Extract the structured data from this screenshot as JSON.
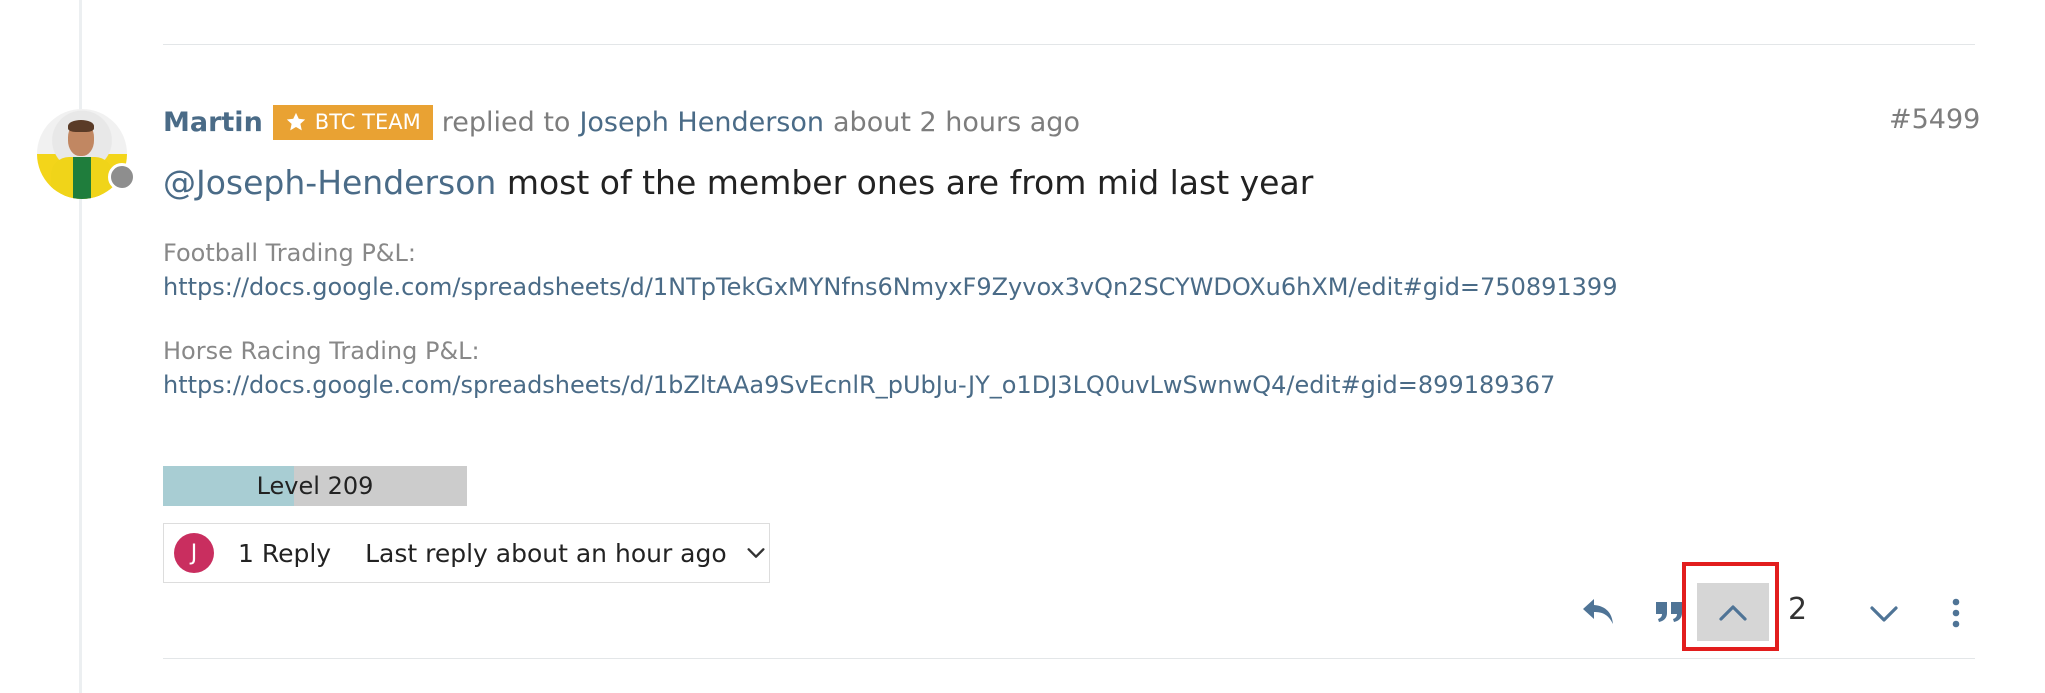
{
  "post": {
    "author": "Martin",
    "badge": "BTC TEAM",
    "replied_to_label": "replied to",
    "replied_to_user": "Joseph Henderson",
    "time": "about 2 hours ago",
    "index": "#5499",
    "mention": "@Joseph-Henderson",
    "body_text": "most of the member ones are from mid last year",
    "football_label": "Football Trading P&L:",
    "football_link": "https://docs.google.com/spreadsheets/d/1NTpTekGxMYNfns6NmyxF9Zyvox3vQn2SCYWDOXu6hXM/edit#gid=750891399",
    "horse_label": "Horse Racing Trading P&L:",
    "horse_link": "https://docs.google.com/spreadsheets/d/1bZltAAa9SvEcnlR_pUbJu-JY_o1DJ3LQ0uvLwSwnwQ4/edit#gid=899189367"
  },
  "level": {
    "label": "Level 209",
    "progress": 0.43
  },
  "replies": {
    "avatar_letter": "J",
    "count_label": "1 Reply",
    "last_reply": "Last reply about an hour ago"
  },
  "votes": {
    "count": "2"
  },
  "icons": {
    "reply": "reply-icon",
    "quote": "quote-icon",
    "upvote": "chevron-up-icon",
    "downvote": "chevron-down-icon",
    "menu": "more-vertical-icon",
    "badge": "star-icon"
  },
  "colors": {
    "link": "#4a6b87",
    "badge_bg": "#e9a233",
    "reply_avatar": "#c92e5f",
    "highlight": "#e21d1d"
  }
}
